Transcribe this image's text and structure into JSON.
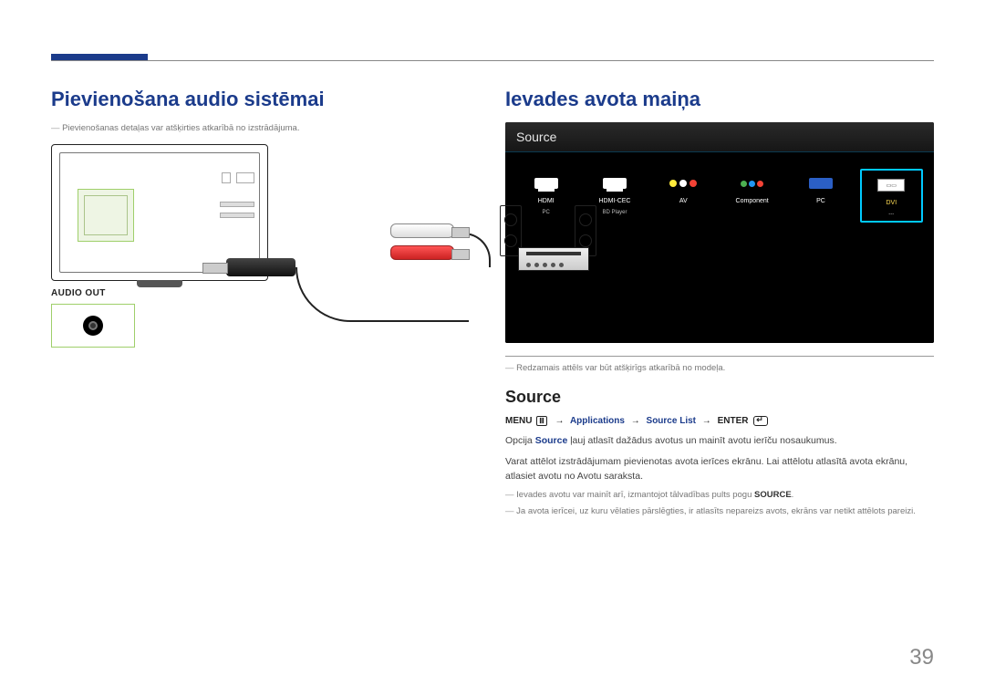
{
  "page_number": "39",
  "left": {
    "title": "Pievienošana audio sistēmai",
    "note": "Pievienošanas detaļas var atšķirties atkarībā no izstrādājuma.",
    "audio_out_label": "AUDIO OUT"
  },
  "right": {
    "title": "Ievades avota maiņa",
    "source_shot": {
      "title": "Source",
      "tiles": [
        {
          "label": "HDMI",
          "sub": "PC",
          "icon": "hdmi",
          "selected": false
        },
        {
          "label": "HDMI-CEC",
          "sub": "BD Player",
          "icon": "hdmi",
          "selected": false
        },
        {
          "label": "AV",
          "sub": "",
          "icon": "av",
          "selected": false
        },
        {
          "label": "Component",
          "sub": "",
          "icon": "comp",
          "selected": false
        },
        {
          "label": "PC",
          "sub": "",
          "icon": "vga",
          "selected": false
        },
        {
          "label": "DVI",
          "sub": "---",
          "icon": "dvi",
          "selected": true
        }
      ]
    },
    "shot_note": "Redzamais attēls var būt atšķirīgs atkarībā no modeļa.",
    "subhead": "Source",
    "menu_path": {
      "menu": "MENU",
      "applications": "Applications",
      "source_list": "Source List",
      "enter": "ENTER"
    },
    "body": [
      {
        "pre": "Opcija ",
        "kw": "Source",
        "post": " ļauj atlasīt dažādus avotus un mainīt avotu ierīču nosaukumus."
      },
      {
        "pre": "Varat attēlot izstrādājumam pievienotas avota ierīces ekrānu. Lai attēlotu atlasītā avota ekrānu, atlasiet avotu no Avotu saraksta.",
        "kw": "",
        "post": ""
      }
    ],
    "notes": [
      {
        "pre": "Ievades avotu var mainīt arī, izmantojot tālvadības pults pogu ",
        "kw": "SOURCE",
        "post": "."
      },
      {
        "pre": "Ja avota ierīcei, uz kuru vēlaties pārslēgties, ir atlasīts nepareizs avots, ekrāns var netikt attēlots pareizi.",
        "kw": "",
        "post": ""
      }
    ]
  }
}
